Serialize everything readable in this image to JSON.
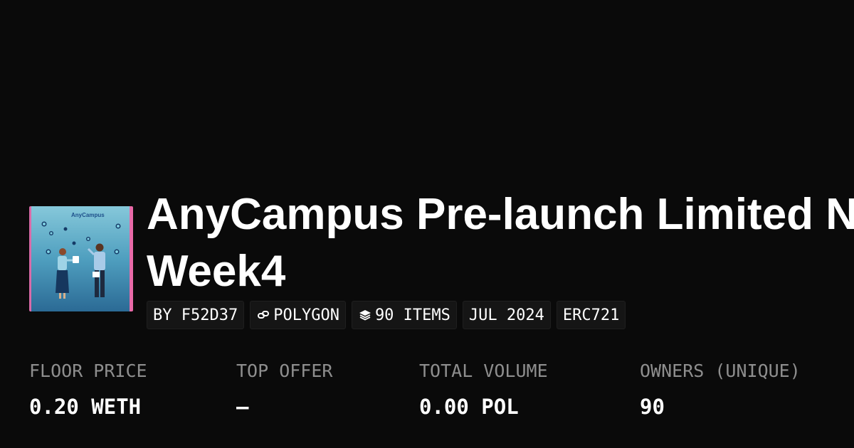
{
  "collection": {
    "title_line1": "AnyCampus Pre-launch Limited NFT",
    "title_line2": "Week4",
    "thumbnail_logo_text": "AnyCampus",
    "thumbnail_icon": "campus-illustration-icon"
  },
  "badges": {
    "creator": "BY F52D37",
    "chain": "POLYGON",
    "chain_icon": "link-icon",
    "items": "90 ITEMS",
    "items_icon": "layers-icon",
    "date": "JUL 2024",
    "standard": "ERC721"
  },
  "stats": {
    "floor_price": {
      "label": "FLOOR PRICE",
      "value": "0.20 WETH"
    },
    "top_offer": {
      "label": "TOP OFFER",
      "value": "—"
    },
    "total_volume": {
      "label": "TOTAL VOLUME",
      "value": "0.00 POL"
    },
    "owners": {
      "label": "OWNERS (UNIQUE)",
      "value": "90"
    }
  },
  "colors": {
    "background": "#0a0a0a",
    "badge_background": "#151515",
    "label_gray": "#8e8e8e",
    "text_white": "#ffffff",
    "thumbnail_accent_pink": "#e86aa8"
  }
}
